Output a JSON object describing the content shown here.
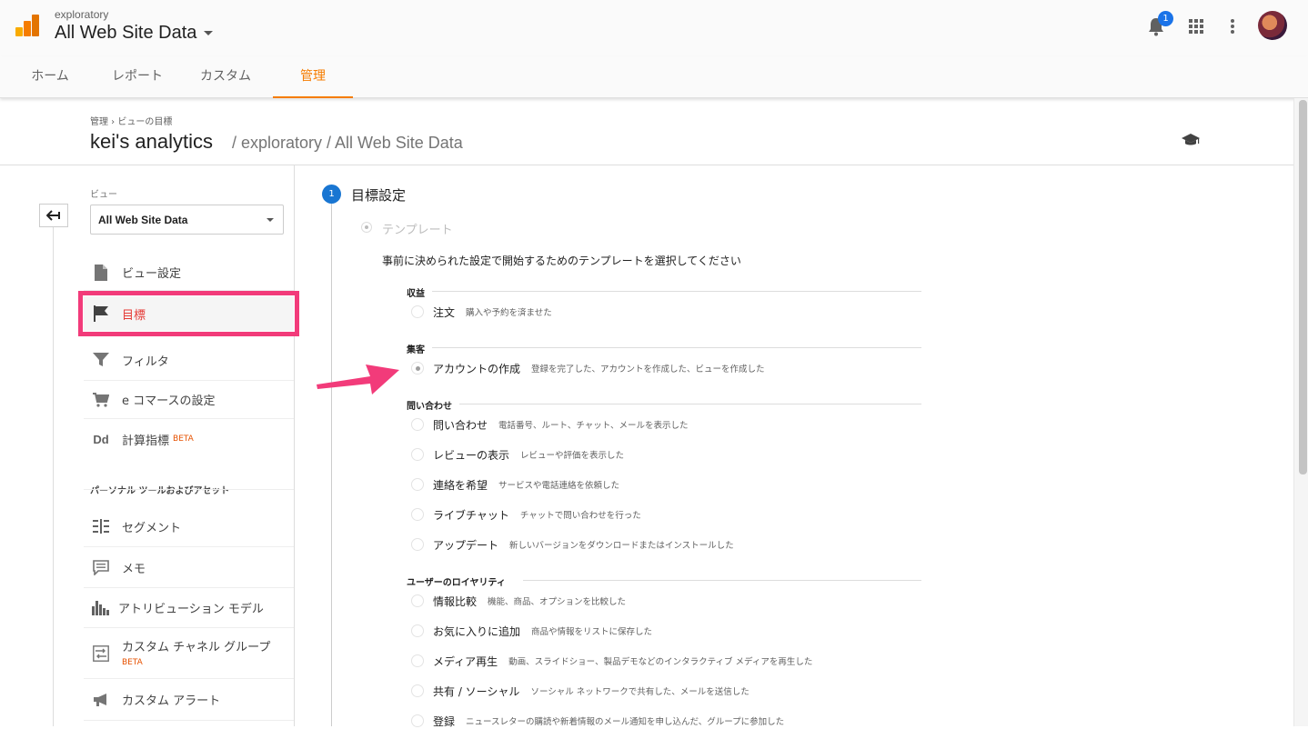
{
  "topbar": {
    "account_small": "exploratory",
    "account_big": "All Web Site Data",
    "notification_count": "1"
  },
  "tabs": [
    "ホーム",
    "レポート",
    "カスタム",
    "管理"
  ],
  "header": {
    "breadcrumb": "管理 › ビューの目標",
    "title": "kei's analytics",
    "path": " / exploratory / All Web Site Data"
  },
  "sidebar": {
    "view_label": "ビュー",
    "view_select": "All Web Site Data",
    "items": [
      {
        "label": "ビュー設定",
        "icon": "document-icon"
      },
      {
        "label": "目標",
        "icon": "flag-icon"
      },
      {
        "label": "フィルタ",
        "icon": "filter-icon"
      },
      {
        "label": "e コマースの設定",
        "icon": "cart-icon"
      },
      {
        "label": "計算指標",
        "icon": "dd-icon",
        "beta": "BETA"
      }
    ],
    "section_title": "パーソナル ツールおよびアセット",
    "tools": [
      {
        "label": "セグメント",
        "icon": "segment-icon"
      },
      {
        "label": "メモ",
        "icon": "comment-icon"
      },
      {
        "label": "アトリビューション モデル",
        "icon": "bar-chart-icon"
      },
      {
        "label": "カスタム チャネル グループ",
        "icon": "channel-icon",
        "beta": "BETA"
      },
      {
        "label": "カスタム アラート",
        "icon": "megaphone-icon"
      }
    ]
  },
  "main": {
    "step_number": "1",
    "step_title": "目標設定",
    "template_label": "テンプレート",
    "instruction": "事前に決められた設定で開始するためのテンプレートを選択してください",
    "groups": [
      {
        "title": "収益",
        "options": [
          {
            "name": "注文",
            "desc": "購入や予約を済ませた",
            "selected": false
          }
        ]
      },
      {
        "title": "集客",
        "options": [
          {
            "name": "アカウントの作成",
            "desc": "登録を完了した、アカウントを作成した、ビューを作成した",
            "selected": true
          }
        ]
      },
      {
        "title": "問い合わせ",
        "options": [
          {
            "name": "問い合わせ",
            "desc": "電話番号、ルート、チャット、メールを表示した",
            "selected": false
          },
          {
            "name": "レビューの表示",
            "desc": "レビューや評価を表示した",
            "selected": false
          },
          {
            "name": "連絡を希望",
            "desc": "サービスや電話連絡を依頼した",
            "selected": false
          },
          {
            "name": "ライブチャット",
            "desc": "チャットで問い合わせを行った",
            "selected": false
          },
          {
            "name": "アップデート",
            "desc": "新しいバージョンをダウンロードまたはインストールした",
            "selected": false
          }
        ]
      },
      {
        "title": "ユーザーのロイヤリティ",
        "options": [
          {
            "name": "情報比較",
            "desc": "機能、商品、オプションを比較した",
            "selected": false
          },
          {
            "name": "お気に入りに追加",
            "desc": "商品や情報をリストに保存した",
            "selected": false
          },
          {
            "name": "メディア再生",
            "desc": "動画、スライドショー、製品デモなどのインタラクティブ メディアを再生した",
            "selected": false
          },
          {
            "name": "共有 / ソーシャル",
            "desc": "ソーシャル ネットワークで共有した、メールを送信した",
            "selected": false
          },
          {
            "name": "登録",
            "desc": "ニュースレターの購読や新着情報のメール通知を申し込んだ、グループに参加した",
            "selected": false
          }
        ]
      }
    ]
  },
  "colors": {
    "accent_orange": "#f57c00",
    "highlight_pink": "#f23b7a",
    "step_blue": "#1976d2",
    "active_red": "#e53935"
  }
}
